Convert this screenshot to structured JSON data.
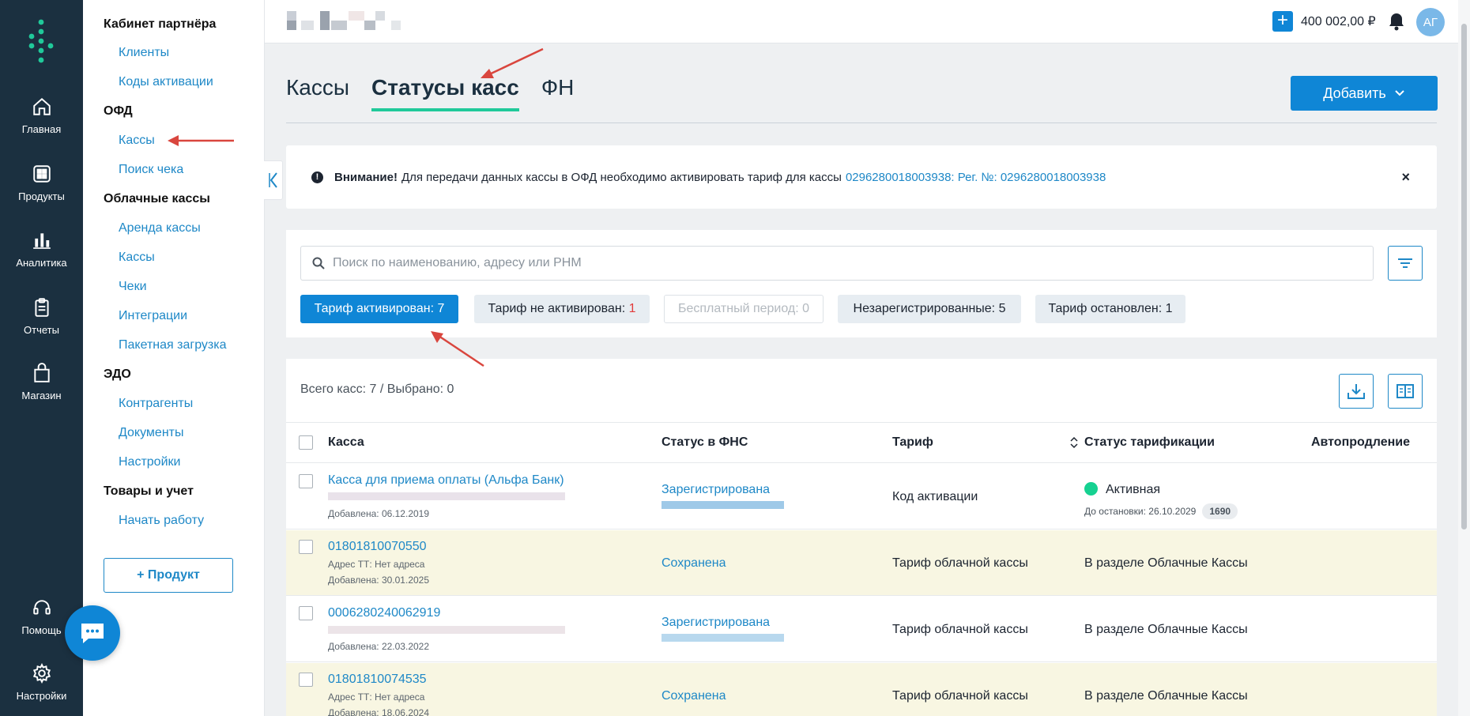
{
  "rail": {
    "items": [
      {
        "label": "Главная",
        "icon": "home-icon"
      },
      {
        "label": "Продукты",
        "icon": "grid-icon"
      },
      {
        "label": "Аналитика",
        "icon": "bar-chart-icon"
      },
      {
        "label": "Отчеты",
        "icon": "clipboard-icon"
      },
      {
        "label": "Магазин",
        "icon": "bag-icon"
      },
      {
        "label": "Помощь",
        "icon": "headset-icon"
      },
      {
        "label": "Настройки",
        "icon": "gear-icon"
      }
    ]
  },
  "subnav": {
    "sections": [
      {
        "title": "Кабинет партнёра",
        "links": [
          "Клиенты",
          "Коды активации"
        ]
      },
      {
        "title": "ОФД",
        "links": [
          "Кассы",
          "Поиск чека"
        ]
      },
      {
        "title": "Облачные кассы",
        "links": [
          "Аренда кассы",
          "Кассы",
          "Чеки",
          "Интеграции",
          "Пакетная загрузка"
        ]
      },
      {
        "title": "ЭДО",
        "links": [
          "Контрагенты",
          "Документы",
          "Настройки"
        ]
      },
      {
        "title": "Товары и учет",
        "links": [
          "Начать работу"
        ]
      }
    ],
    "add_product": "+ Продукт"
  },
  "topbar": {
    "balance": "400 002,00 ₽",
    "avatar": "АГ"
  },
  "tabs": [
    {
      "label": "Кассы",
      "active": false
    },
    {
      "label": "Статусы касс",
      "active": true
    },
    {
      "label": "ФН",
      "active": false
    }
  ],
  "add_button": "Добавить",
  "alert": {
    "title": "Внимание!",
    "text": "Для передачи данных кассы в ОФД необходимо активировать тариф для кассы",
    "link": "0296280018003938: Рег. №: 0296280018003938",
    "close": "×"
  },
  "search": {
    "placeholder": "Поиск по наименованию, адресу или РНМ"
  },
  "chips": [
    {
      "label": "Тариф активирован:",
      "count": "7"
    },
    {
      "label": "Тариф не активирован:",
      "count": "1"
    },
    {
      "label": "Бесплатный период:",
      "count": "0"
    },
    {
      "label": "Незарегистрированные:",
      "count": "5"
    },
    {
      "label": "Тариф остановлен:",
      "count": "1"
    }
  ],
  "summary": "Всего касс: 7  /  Выбрано: 0",
  "table": {
    "columns": [
      "Касса",
      "Статус в ФНС",
      "Тариф",
      "Статус тарификации",
      "Автопродление"
    ],
    "rows": [
      {
        "name": "Касса для приема оплаты (Альфа Банк)",
        "address": "",
        "added": "Добавлена: 06.12.2019",
        "fns": "Зарегистрирована",
        "tariff": "Код активации",
        "status": "Активная",
        "until": "До остановки: 26.10.2029",
        "days": "1690",
        "highlight": false
      },
      {
        "name": "01801810070550",
        "address": "Адрес ТТ: Нет адреса",
        "added": "Добавлена: 30.01.2025",
        "fns": "Сохранена",
        "tariff": "Тариф облачной кассы",
        "status": "В разделе Облачные Кассы",
        "highlight": true
      },
      {
        "name": "0006280240062919",
        "address": "",
        "added": "Добавлена: 22.03.2022",
        "fns": "Зарегистрирована",
        "tariff": "Тариф облачной кассы",
        "status": "В разделе Облачные Кассы",
        "highlight": false
      },
      {
        "name": "01801810074535",
        "address": "Адрес ТТ: Нет адреса",
        "added": "Добавлена: 18.06.2024",
        "fns": "Сохранена",
        "tariff": "Тариф облачной кассы",
        "status": "В разделе Облачные Кассы",
        "highlight": true
      }
    ]
  },
  "colors": {
    "accent": "#0f86d6",
    "link": "#1e88c7",
    "rail": "#1b3040",
    "active_tab": "#20c99a",
    "status_active": "#16d191",
    "highlight_row": "#f8f6e2",
    "annotation_arrow": "#d9463e"
  }
}
